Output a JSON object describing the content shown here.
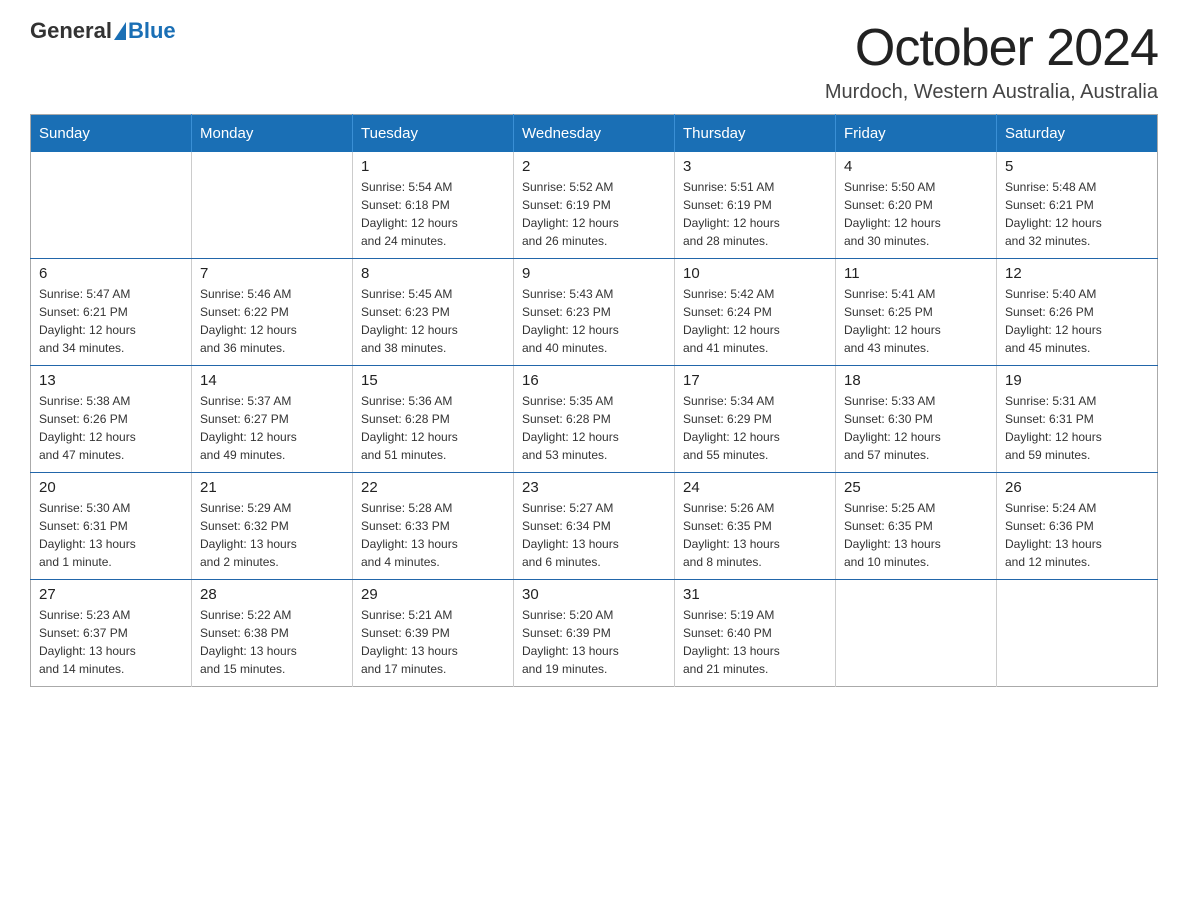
{
  "header": {
    "logo": {
      "general": "General",
      "blue": "Blue"
    },
    "title": "October 2024",
    "location": "Murdoch, Western Australia, Australia"
  },
  "weekdays": [
    "Sunday",
    "Monday",
    "Tuesday",
    "Wednesday",
    "Thursday",
    "Friday",
    "Saturday"
  ],
  "weeks": [
    [
      {
        "day": "",
        "info": ""
      },
      {
        "day": "",
        "info": ""
      },
      {
        "day": "1",
        "info": "Sunrise: 5:54 AM\nSunset: 6:18 PM\nDaylight: 12 hours\nand 24 minutes."
      },
      {
        "day": "2",
        "info": "Sunrise: 5:52 AM\nSunset: 6:19 PM\nDaylight: 12 hours\nand 26 minutes."
      },
      {
        "day": "3",
        "info": "Sunrise: 5:51 AM\nSunset: 6:19 PM\nDaylight: 12 hours\nand 28 minutes."
      },
      {
        "day": "4",
        "info": "Sunrise: 5:50 AM\nSunset: 6:20 PM\nDaylight: 12 hours\nand 30 minutes."
      },
      {
        "day": "5",
        "info": "Sunrise: 5:48 AM\nSunset: 6:21 PM\nDaylight: 12 hours\nand 32 minutes."
      }
    ],
    [
      {
        "day": "6",
        "info": "Sunrise: 5:47 AM\nSunset: 6:21 PM\nDaylight: 12 hours\nand 34 minutes."
      },
      {
        "day": "7",
        "info": "Sunrise: 5:46 AM\nSunset: 6:22 PM\nDaylight: 12 hours\nand 36 minutes."
      },
      {
        "day": "8",
        "info": "Sunrise: 5:45 AM\nSunset: 6:23 PM\nDaylight: 12 hours\nand 38 minutes."
      },
      {
        "day": "9",
        "info": "Sunrise: 5:43 AM\nSunset: 6:23 PM\nDaylight: 12 hours\nand 40 minutes."
      },
      {
        "day": "10",
        "info": "Sunrise: 5:42 AM\nSunset: 6:24 PM\nDaylight: 12 hours\nand 41 minutes."
      },
      {
        "day": "11",
        "info": "Sunrise: 5:41 AM\nSunset: 6:25 PM\nDaylight: 12 hours\nand 43 minutes."
      },
      {
        "day": "12",
        "info": "Sunrise: 5:40 AM\nSunset: 6:26 PM\nDaylight: 12 hours\nand 45 minutes."
      }
    ],
    [
      {
        "day": "13",
        "info": "Sunrise: 5:38 AM\nSunset: 6:26 PM\nDaylight: 12 hours\nand 47 minutes."
      },
      {
        "day": "14",
        "info": "Sunrise: 5:37 AM\nSunset: 6:27 PM\nDaylight: 12 hours\nand 49 minutes."
      },
      {
        "day": "15",
        "info": "Sunrise: 5:36 AM\nSunset: 6:28 PM\nDaylight: 12 hours\nand 51 minutes."
      },
      {
        "day": "16",
        "info": "Sunrise: 5:35 AM\nSunset: 6:28 PM\nDaylight: 12 hours\nand 53 minutes."
      },
      {
        "day": "17",
        "info": "Sunrise: 5:34 AM\nSunset: 6:29 PM\nDaylight: 12 hours\nand 55 minutes."
      },
      {
        "day": "18",
        "info": "Sunrise: 5:33 AM\nSunset: 6:30 PM\nDaylight: 12 hours\nand 57 minutes."
      },
      {
        "day": "19",
        "info": "Sunrise: 5:31 AM\nSunset: 6:31 PM\nDaylight: 12 hours\nand 59 minutes."
      }
    ],
    [
      {
        "day": "20",
        "info": "Sunrise: 5:30 AM\nSunset: 6:31 PM\nDaylight: 13 hours\nand 1 minute."
      },
      {
        "day": "21",
        "info": "Sunrise: 5:29 AM\nSunset: 6:32 PM\nDaylight: 13 hours\nand 2 minutes."
      },
      {
        "day": "22",
        "info": "Sunrise: 5:28 AM\nSunset: 6:33 PM\nDaylight: 13 hours\nand 4 minutes."
      },
      {
        "day": "23",
        "info": "Sunrise: 5:27 AM\nSunset: 6:34 PM\nDaylight: 13 hours\nand 6 minutes."
      },
      {
        "day": "24",
        "info": "Sunrise: 5:26 AM\nSunset: 6:35 PM\nDaylight: 13 hours\nand 8 minutes."
      },
      {
        "day": "25",
        "info": "Sunrise: 5:25 AM\nSunset: 6:35 PM\nDaylight: 13 hours\nand 10 minutes."
      },
      {
        "day": "26",
        "info": "Sunrise: 5:24 AM\nSunset: 6:36 PM\nDaylight: 13 hours\nand 12 minutes."
      }
    ],
    [
      {
        "day": "27",
        "info": "Sunrise: 5:23 AM\nSunset: 6:37 PM\nDaylight: 13 hours\nand 14 minutes."
      },
      {
        "day": "28",
        "info": "Sunrise: 5:22 AM\nSunset: 6:38 PM\nDaylight: 13 hours\nand 15 minutes."
      },
      {
        "day": "29",
        "info": "Sunrise: 5:21 AM\nSunset: 6:39 PM\nDaylight: 13 hours\nand 17 minutes."
      },
      {
        "day": "30",
        "info": "Sunrise: 5:20 AM\nSunset: 6:39 PM\nDaylight: 13 hours\nand 19 minutes."
      },
      {
        "day": "31",
        "info": "Sunrise: 5:19 AM\nSunset: 6:40 PM\nDaylight: 13 hours\nand 21 minutes."
      },
      {
        "day": "",
        "info": ""
      },
      {
        "day": "",
        "info": ""
      }
    ]
  ]
}
